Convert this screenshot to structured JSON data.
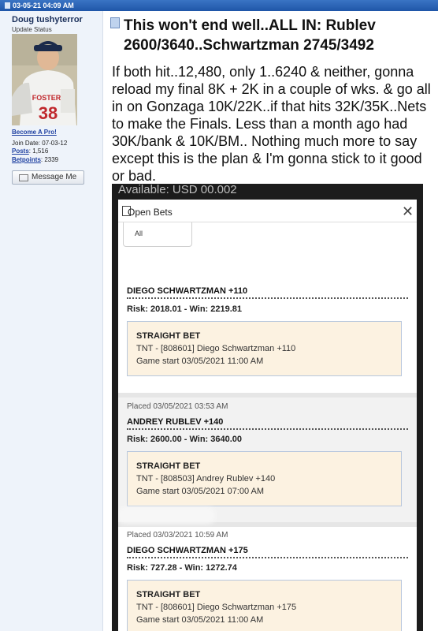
{
  "header": {
    "datetime": "03-05-21 04:09 AM"
  },
  "user": {
    "name": "Doug tushyterror",
    "status": "Update Status",
    "become_pro": "Become A Pro!",
    "join_label": "Join Date: 07-03-12",
    "posts_label": "Posts",
    "posts_value": ": 1,516",
    "betpoints_label": "Betpoints",
    "betpoints_value": ": 2339",
    "message_button": "Message Me",
    "avatar_jersey_number": "38",
    "avatar_jersey_text": "FOSTER"
  },
  "post": {
    "title": "This won't end well..ALL IN: Rublev 2600/3640..Schwartzman 2745/3492",
    "body": "If both hit..12,480, only 1..6240 & neither, gonna reload my final 8K + 2K in a couple of wks. & go all in on Gonzaga 10K/22K..if that hits 32K/35K..Nets to make the Finals. Less than a month ago had 30K/bank & 10K/BM.. Nothing much more to say except this is the plan & I'm gonna stick to it good or bad."
  },
  "screenshot": {
    "available": "Available: USD 00.002",
    "panel_title": "Open Bets",
    "filter_value": "All",
    "bets": [
      {
        "placed": "",
        "selection": "DIEGO SCHWARTZMAN +110",
        "risk_win": "Risk: 2018.01 - Win: 2219.81",
        "type": "STRAIGHT BET",
        "detail": "TNT - [808601] Diego Schwartzman +110",
        "game_start": "Game start 03/05/2021 11:00 AM"
      },
      {
        "placed": "Placed   03/05/2021  03:53 AM",
        "selection": "ANDREY RUBLEV +140",
        "risk_win": "Risk: 2600.00 - Win: 3640.00",
        "type": "STRAIGHT BET",
        "detail": "TNT - [808503] Andrey Rublev +140",
        "game_start": "Game start 03/05/2021 07:00 AM"
      },
      {
        "placed": "Placed   03/03/2021  10:59 AM",
        "selection": "DIEGO SCHWARTZMAN +175",
        "risk_win": "Risk: 727.28 - Win: 1272.74",
        "type": "STRAIGHT BET",
        "detail": "TNT - [808601] Diego Schwartzman +175",
        "game_start": "Game start 03/05/2021 11:00 AM"
      }
    ]
  },
  "colors": {
    "header_bar": "#2a64b8",
    "sidebar": "#eef3fa",
    "card_bg": "#fcf2e1",
    "link": "#1d3fa0"
  }
}
